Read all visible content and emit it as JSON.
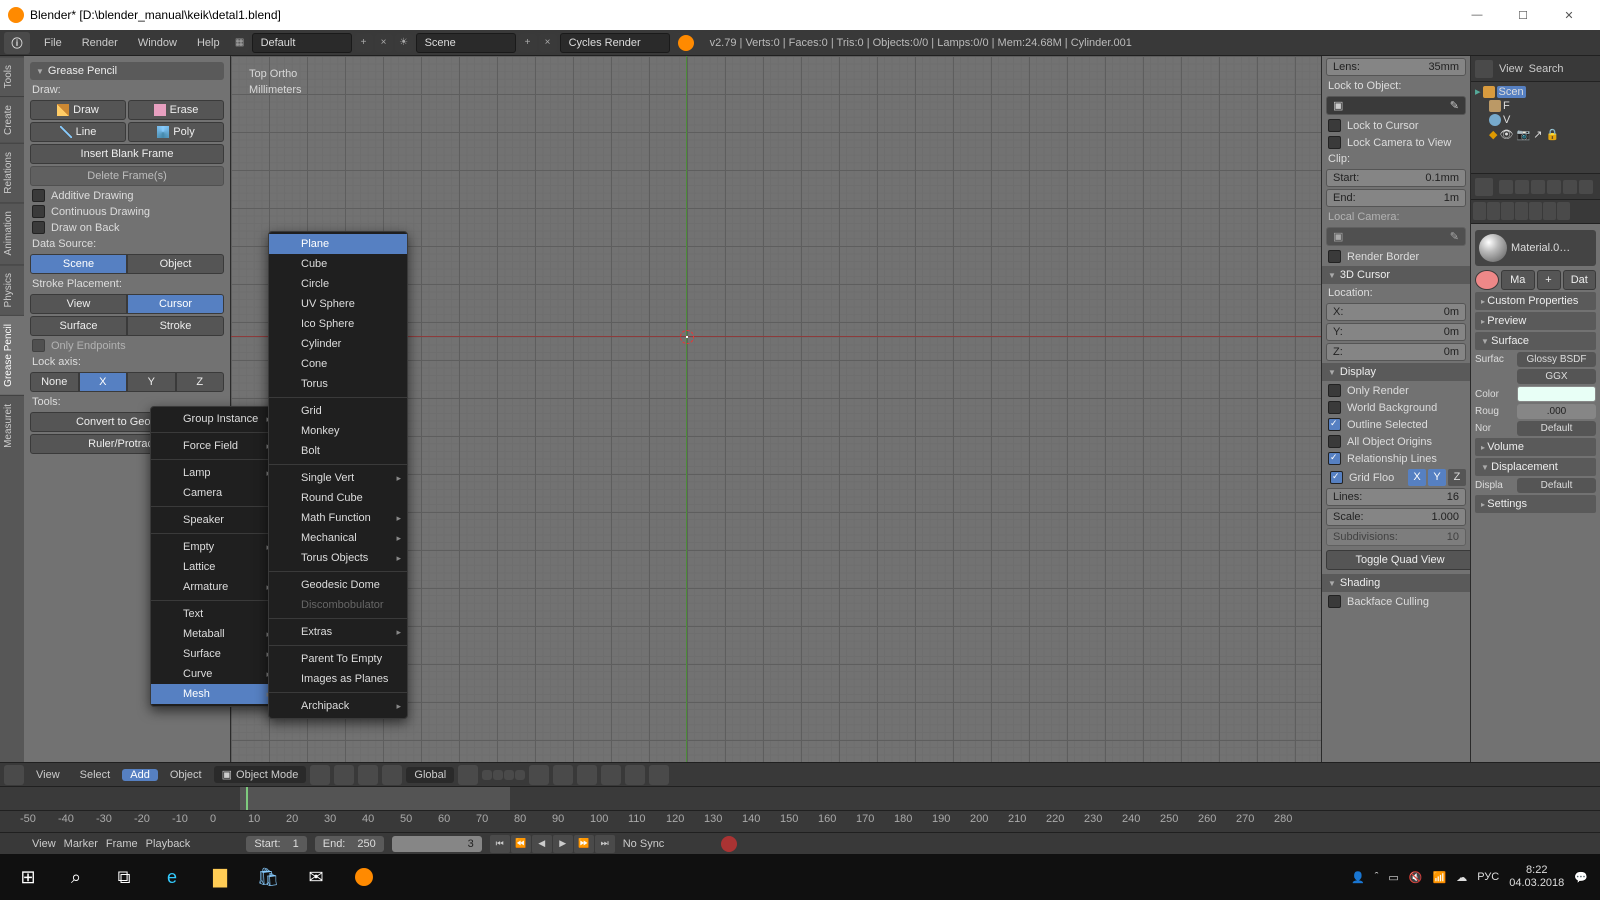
{
  "window": {
    "title": "Blender* [D:\\blender_manual\\keik\\detal1.blend]"
  },
  "topbar": {
    "menus": [
      "File",
      "Render",
      "Window",
      "Help"
    ],
    "layout": "Default",
    "scene": "Scene",
    "engine": "Cycles Render",
    "stats": "v2.79 | Verts:0 | Faces:0 | Tris:0 | Objects:0/0 | Lamps:0/0 | Mem:24.68M | Cylinder.001"
  },
  "tooltabs": [
    "Tools",
    "Create",
    "Relations",
    "Animation",
    "Physics",
    "Grease Pencil",
    "Measureit"
  ],
  "gp": {
    "header": "Grease Pencil",
    "draw_label": "Draw:",
    "btn_draw": "Draw",
    "btn_erase": "Erase",
    "btn_line": "Line",
    "btn_poly": "Poly",
    "insert_blank": "Insert Blank Frame",
    "delete_frames": "Delete Frame(s)",
    "additive": "Additive Drawing",
    "continuous": "Continuous Drawing",
    "draw_on_back": "Draw on Back",
    "data_source": "Data Source:",
    "ds_scene": "Scene",
    "ds_object": "Object",
    "stroke_placement": "Stroke Placement:",
    "sp_view": "View",
    "sp_cursor": "Cursor",
    "sp_surface": "Surface",
    "sp_stroke": "Stroke",
    "only_endpoints": "Only Endpoints",
    "lock_axis": "Lock axis:",
    "la_none": "None",
    "la_x": "X",
    "la_y": "Y",
    "la_z": "Z",
    "tools": "Tools:",
    "convert": "Convert to Geometry",
    "ruler": "Ruler/Protractor"
  },
  "viewport": {
    "label1": "Top Ortho",
    "label2": "Millimeters"
  },
  "addmenu": {
    "items": [
      {
        "t": "Group Instance",
        "sub": true
      },
      {
        "sep": true
      },
      {
        "t": "Force Field",
        "sub": true
      },
      {
        "sep": true
      },
      {
        "t": "Lamp",
        "sub": true
      },
      {
        "t": "Camera"
      },
      {
        "sep": true
      },
      {
        "t": "Speaker"
      },
      {
        "sep": true
      },
      {
        "t": "Empty",
        "sub": true
      },
      {
        "t": "Lattice"
      },
      {
        "t": "Armature",
        "sub": true
      },
      {
        "sep": true
      },
      {
        "t": "Text"
      },
      {
        "t": "Metaball",
        "sub": true
      },
      {
        "t": "Surface",
        "sub": true
      },
      {
        "t": "Curve",
        "sub": true
      },
      {
        "t": "Mesh",
        "sub": true,
        "hl": true
      }
    ]
  },
  "meshmenu": {
    "items": [
      {
        "t": "Plane",
        "hl": true
      },
      {
        "t": "Cube"
      },
      {
        "t": "Circle"
      },
      {
        "t": "UV Sphere"
      },
      {
        "t": "Ico Sphere"
      },
      {
        "t": "Cylinder"
      },
      {
        "t": "Cone"
      },
      {
        "t": "Torus"
      },
      {
        "sep": true
      },
      {
        "t": "Grid"
      },
      {
        "t": "Monkey"
      },
      {
        "t": "Bolt"
      },
      {
        "sep": true
      },
      {
        "t": "Single Vert",
        "sub": true
      },
      {
        "t": "Round Cube"
      },
      {
        "t": "Math Function",
        "sub": true
      },
      {
        "t": "Mechanical",
        "sub": true
      },
      {
        "t": "Torus Objects",
        "sub": true
      },
      {
        "sep": true
      },
      {
        "t": "Geodesic Dome"
      },
      {
        "t": "Discombobulator",
        "disabled": true
      },
      {
        "sep": true
      },
      {
        "t": "Extras",
        "sub": true
      },
      {
        "sep": true
      },
      {
        "t": "Parent To Empty"
      },
      {
        "t": "Images as Planes"
      },
      {
        "sep": true
      },
      {
        "t": "Archipack",
        "sub": true
      }
    ]
  },
  "npanel": {
    "lens_label": "Lens:",
    "lens_val": "35mm",
    "lock_obj": "Lock to Object:",
    "lock_cursor": "Lock to Cursor",
    "lock_cam": "Lock Camera to View",
    "clip": "Clip:",
    "clip_start_l": "Start:",
    "clip_start_v": "0.1mm",
    "clip_end_l": "End:",
    "clip_end_v": "1m",
    "local_cam": "Local Camera:",
    "render_border": "Render Border",
    "cursor_hdr": "3D Cursor",
    "loc": "Location:",
    "x_l": "X:",
    "x_v": "0m",
    "y_l": "Y:",
    "y_v": "0m",
    "z_l": "Z:",
    "z_v": "0m",
    "display_hdr": "Display",
    "only_render": "Only Render",
    "world_bg": "World Background",
    "outline_sel": "Outline Selected",
    "all_origins": "All Object Origins",
    "rel_lines": "Relationship Lines",
    "grid_floor": "Grid Floo",
    "gx": "X",
    "gy": "Y",
    "gz": "Z",
    "lines_l": "Lines:",
    "lines_v": "16",
    "scale_l": "Scale:",
    "scale_v": "1.000",
    "subdiv_l": "Subdivisions:",
    "subdiv_v": "10",
    "toggle_quad": "Toggle Quad View",
    "shading_hdr": "Shading",
    "backface": "Backface Culling"
  },
  "props": {
    "view": "View",
    "search": "Search",
    "scene": "Scen",
    "mat_name": "Material.0…",
    "ma": "Ma",
    "dat": "Dat",
    "custom_props": "Custom Properties",
    "preview": "Preview",
    "surface_hdr": "Surface",
    "surface_l": "Surfac",
    "surface_v": "Glossy BSDF",
    "dist_v": "GGX",
    "color_l": "Color",
    "rough_l": "Roug",
    "rough_v": ".000",
    "normal_l": "Nor",
    "normal_v": "Default",
    "volume": "Volume",
    "displacement_hdr": "Displacement",
    "displ_l": "Displa",
    "displ_v": "Default",
    "settings": "Settings"
  },
  "hdr3d": {
    "view": "View",
    "select": "Select",
    "add": "Add",
    "object": "Object",
    "mode": "Object Mode",
    "orient": "Global"
  },
  "timeline": {
    "ticks": [
      -50,
      -40,
      -30,
      -20,
      -10,
      0,
      10,
      20,
      30,
      40,
      50,
      60,
      70,
      80,
      90,
      100,
      110,
      120,
      130,
      140,
      150,
      160,
      170,
      180,
      190,
      200,
      210,
      220,
      230,
      240,
      250,
      260,
      270,
      280
    ],
    "view": "View",
    "marker": "Marker",
    "frame": "Frame",
    "playback": "Playback",
    "start_l": "Start:",
    "start_v": "1",
    "end_l": "End:",
    "end_v": "250",
    "current": "3",
    "sync": "No Sync"
  },
  "taskbar": {
    "lang": "РУС",
    "time": "8:22",
    "date": "04.03.2018"
  }
}
